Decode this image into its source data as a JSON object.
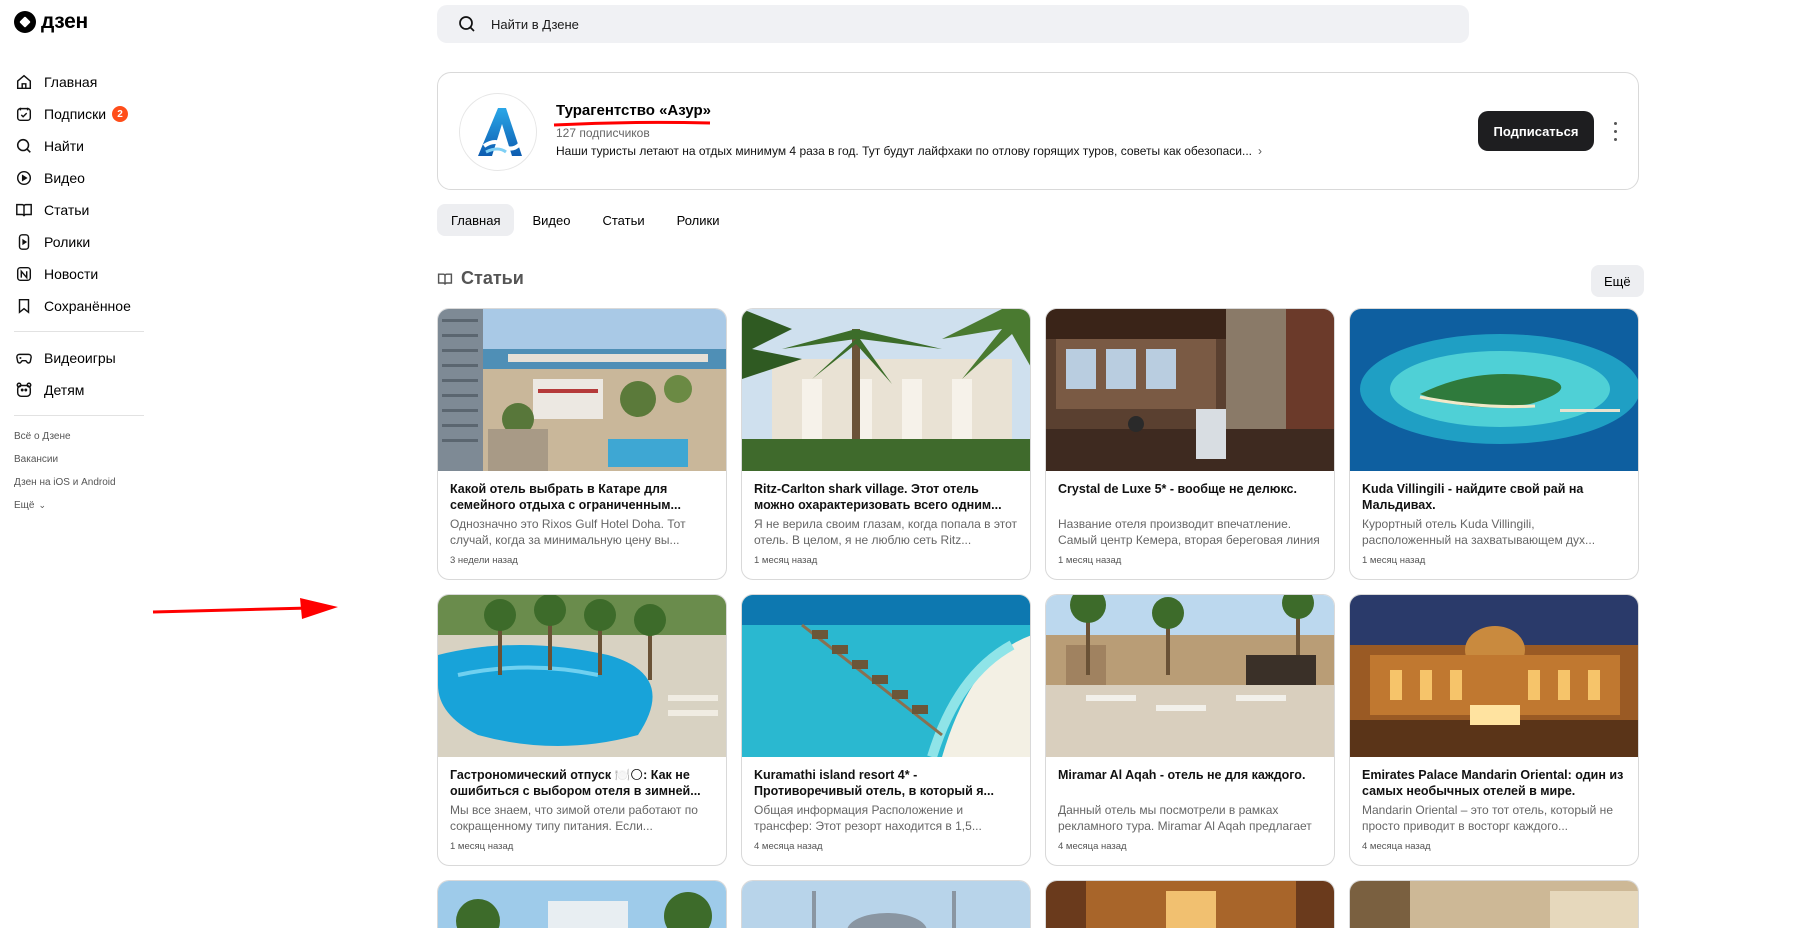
{
  "logo": {
    "text": "дзен"
  },
  "sidebar": {
    "items": [
      {
        "label": "Главная",
        "icon": "home-icon"
      },
      {
        "label": "Подписки",
        "icon": "subscriptions-icon",
        "badge": "2"
      },
      {
        "label": "Найти",
        "icon": "search-icon"
      },
      {
        "label": "Видео",
        "icon": "video-icon"
      },
      {
        "label": "Статьи",
        "icon": "articles-icon"
      },
      {
        "label": "Ролики",
        "icon": "shorts-icon"
      },
      {
        "label": "Новости",
        "icon": "news-icon"
      },
      {
        "label": "Сохранённое",
        "icon": "bookmark-icon"
      }
    ],
    "extra_items": [
      {
        "label": "Видеоигры",
        "icon": "gamepad-icon"
      },
      {
        "label": "Детям",
        "icon": "kids-icon"
      }
    ],
    "footer": [
      "Всё о Дзене",
      "Вакансии",
      "Дзен на iOS и Android",
      "Ещё"
    ]
  },
  "search": {
    "placeholder": "Найти в Дзене"
  },
  "channel": {
    "name": "Турагентство «Азур»",
    "subscribers": "127 подписчиков",
    "description": "Наши туристы летают на отдых минимум 4 раза в год. Тут будут лайфхаки по отлову горящих туров, советы как обезопаси...",
    "subscribe_label": "Подписаться",
    "avatar_letter": "A"
  },
  "tabs": [
    "Главная",
    "Видео",
    "Статьи",
    "Ролики"
  ],
  "section": {
    "title": "Статьи",
    "more_label": "Ещё"
  },
  "colors": {
    "accent_badge": "#ff4e1a",
    "button_dark": "#1e1e20",
    "annotation_red": "#ff0000"
  },
  "cards": [
    {
      "title": "Какой отель выбрать в Катаре для семейного отдыха с ограниченным...",
      "desc": "Однозначно это Rixos Gulf Hotel Doha. Тот случай, когда за минимальную цену вы...",
      "time": "3 недели назад"
    },
    {
      "title": "Ritz-Carlton shark village. Этот отель можно охарактеризовать всего одним...",
      "desc": "Я не верила своим глазам, когда попала в этот отель. В целом, я не люблю сеть Ritz...",
      "time": "1 месяц назад"
    },
    {
      "title": "Crystal de Luxe 5* - вообще не делюкс.",
      "desc": "Название отеля производит впечатление. Самый центр Кемера, вторая береговая линия и качественный сетевой сервис....",
      "time": "1 месяц назад"
    },
    {
      "title": "Kuda Villingili - найдите свой рай на Мальдивах.",
      "desc": "Курортный отель Kuda Villingili, расположенный на захватывающем дух...",
      "time": "1 месяц назад"
    },
    {
      "title": "Гастрономический отпуск 🍽️🌕: Как не ошибиться с выбором отеля в зимней...",
      "desc": "Мы все знаем, что зимой отели работают по сокращенному типу питания. Если...",
      "time": "1 месяц назад"
    },
    {
      "title": "Kuramathi island resort 4* - Противоречивый отель, в который я...",
      "desc": "Общая информация Расположение и трансфер: Этот резорт находится в 1,5...",
      "time": "4 месяца назад"
    },
    {
      "title": "Miramar Al Aqah - отель не для каждого.",
      "desc": "Данный отель мы посмотрели в рамках рекламного тура. Miramar Al Aqah предлагает два типа питания - всё...",
      "time": "4 месяца назад"
    },
    {
      "title": "Emirates Palace Mandarin Oriental: один из самых необычных отелей в мире.",
      "desc": "Mandarin Oriental – это тот отель, который не просто приводит в восторг каждого...",
      "time": "4 месяца назад"
    }
  ]
}
